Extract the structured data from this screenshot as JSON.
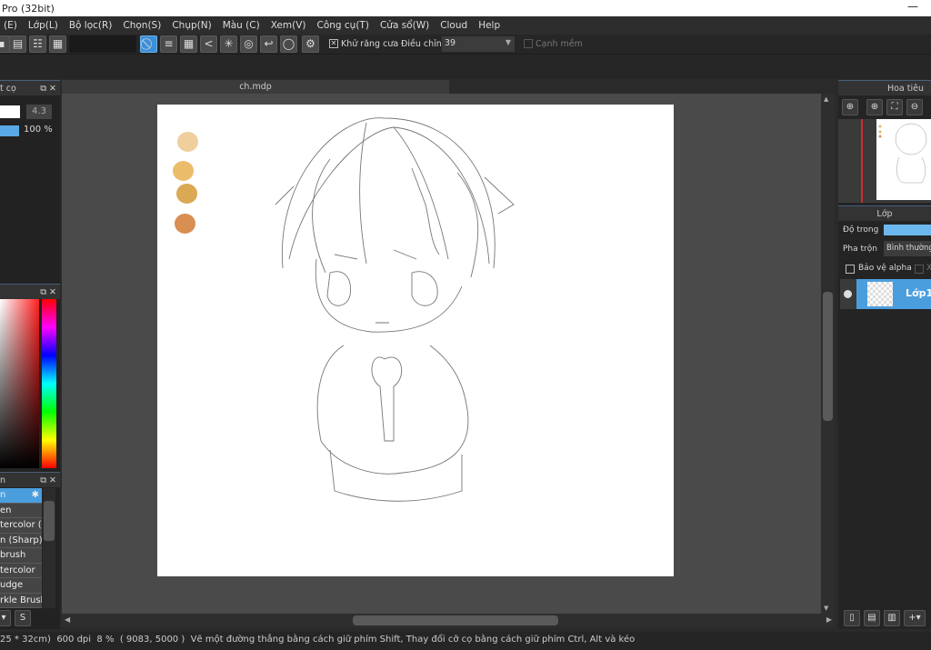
{
  "window": {
    "title": "Pro (32bit)",
    "minimize": "—"
  },
  "menu": [
    "(E)",
    "Lớp(L)",
    "Bộ lọc(R)",
    "Chọn(S)",
    "Chụp(N)",
    "Màu (C)",
    "Xem(V)",
    "Công cụ(T)",
    "Cửa sổ(W)",
    "Cloud",
    "Help"
  ],
  "toolbar": {
    "antialias_label": "Khử răng cưa",
    "antialias_checked": true,
    "adjust_label": "Điều chỉnh",
    "adjust_value": "39",
    "soft_edge_label": "Cạnh mềm",
    "soft_edge_checked": false
  },
  "brush_panel": {
    "title": "t cọ",
    "size_value": "4.3",
    "opacity_value": "100 %",
    "opacity_fraction": 1.0
  },
  "brush_list": {
    "title": "n",
    "items": [
      "n",
      "en",
      "tercolor (V",
      "n (Sharp)",
      "brush",
      "tercolor",
      "udge",
      "rkle Brush"
    ],
    "selected_index": 0
  },
  "document": {
    "tab": "ch.mdp"
  },
  "swatches": [
    "#f0cf9c",
    "#ebbd6a",
    "#dba853",
    "#d98e52"
  ],
  "navigator": {
    "title": "Hoa tiêu"
  },
  "layers": {
    "title": "Lớp",
    "opacity_label": "Độ trong",
    "blend_label": "Pha trộn",
    "blend_value": "Bình thường",
    "alpha_label": "Bảo vệ alpha",
    "clip_label": "X",
    "items": [
      {
        "name": "Lớp1",
        "visible": true,
        "selected": true
      }
    ]
  },
  "status": {
    "size": "25 * 32cm)",
    "dpi": "600 dpi",
    "zoom": "8 %",
    "coords": "( 9083, 5000 )",
    "hint": "Vẽ một đường thẳng bằng cách giữ phím Shift, Thay đổi cỡ cọ bằng cách giữ phím Ctrl, Alt và kéo"
  }
}
